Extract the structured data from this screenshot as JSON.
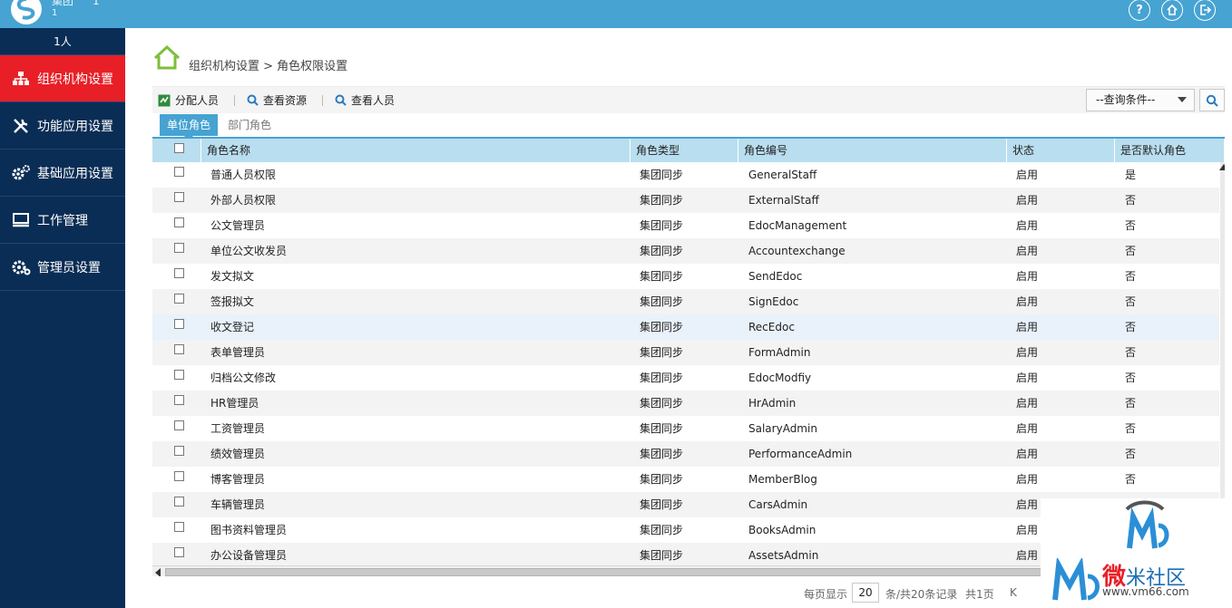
{
  "header": {
    "org_name": "集团",
    "org_id": "1",
    "org_sub": "1"
  },
  "sidebar": {
    "user_count": "1人",
    "items": [
      {
        "label": "组织机构设置",
        "icon": "org-chart-icon",
        "active": true
      },
      {
        "label": "功能应用设置",
        "icon": "tools-icon",
        "active": false
      },
      {
        "label": "基础应用设置",
        "icon": "gears-icon",
        "active": false
      },
      {
        "label": "工作管理",
        "icon": "monitor-icon",
        "active": false
      },
      {
        "label": "管理员设置",
        "icon": "gear-icon",
        "active": false
      }
    ]
  },
  "breadcrumb": {
    "text": "组织机构设置 > 角色权限设置",
    "icon": "home-icon"
  },
  "toolbar": {
    "assign": "分配人员",
    "view_resources": "查看资源",
    "view_members": "查看人员",
    "query_placeholder": "--查询条件--"
  },
  "tabs": {
    "unit_role": "单位角色",
    "dept_role": "部门角色"
  },
  "table": {
    "headers": {
      "name": "角色名称",
      "type": "角色类型",
      "code": "角色编号",
      "status": "状态",
      "default": "是否默认角色"
    },
    "rows": [
      {
        "name": "普通人员权限",
        "type": "集团同步",
        "code": "GeneralStaff",
        "status": "启用",
        "default": "是"
      },
      {
        "name": "外部人员权限",
        "type": "集团同步",
        "code": "ExternalStaff",
        "status": "启用",
        "default": "否"
      },
      {
        "name": "公文管理员",
        "type": "集团同步",
        "code": "EdocManagement",
        "status": "启用",
        "default": "否"
      },
      {
        "name": "单位公文收发员",
        "type": "集团同步",
        "code": "Accountexchange",
        "status": "启用",
        "default": "否"
      },
      {
        "name": "发文拟文",
        "type": "集团同步",
        "code": "SendEdoc",
        "status": "启用",
        "default": "否"
      },
      {
        "name": "签报拟文",
        "type": "集团同步",
        "code": "SignEdoc",
        "status": "启用",
        "default": "否"
      },
      {
        "name": "收文登记",
        "type": "集团同步",
        "code": "RecEdoc",
        "status": "启用",
        "default": "否"
      },
      {
        "name": "表单管理员",
        "type": "集团同步",
        "code": "FormAdmin",
        "status": "启用",
        "default": "否"
      },
      {
        "name": "归档公文修改",
        "type": "集团同步",
        "code": "EdocModfiy",
        "status": "启用",
        "default": "否"
      },
      {
        "name": "HR管理员",
        "type": "集团同步",
        "code": "HrAdmin",
        "status": "启用",
        "default": "否"
      },
      {
        "name": "工资管理员",
        "type": "集团同步",
        "code": "SalaryAdmin",
        "status": "启用",
        "default": "否"
      },
      {
        "name": "绩效管理员",
        "type": "集团同步",
        "code": "PerformanceAdmin",
        "status": "启用",
        "default": "否"
      },
      {
        "name": "博客管理员",
        "type": "集团同步",
        "code": "MemberBlog",
        "status": "启用",
        "default": "否"
      },
      {
        "name": "车辆管理员",
        "type": "集团同步",
        "code": "CarsAdmin",
        "status": "启用",
        "default": ""
      },
      {
        "name": "图书资料管理员",
        "type": "集团同步",
        "code": "BooksAdmin",
        "status": "启用",
        "default": ""
      },
      {
        "name": "办公设备管理员",
        "type": "集团同步",
        "code": "AssetsAdmin",
        "status": "启用",
        "default": ""
      }
    ]
  },
  "pager": {
    "per_page_label": "每页显示",
    "per_page": "20",
    "summary": "条/共20条记录",
    "pages": "共1页",
    "first": "K"
  },
  "watermark": {
    "title_a": "微",
    "title_b": "米社区",
    "site": "www.vm66.com"
  },
  "colors": {
    "header": "#46a3d2",
    "sidebar": "#0a2d55",
    "active": "#e81f27",
    "table_header": "#b9deef"
  }
}
